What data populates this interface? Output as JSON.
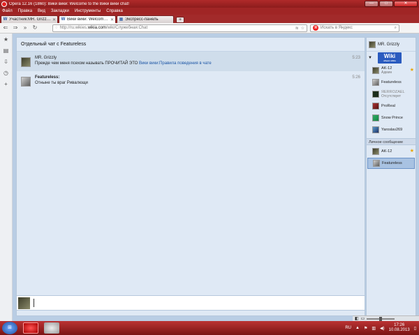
{
  "window": {
    "title": "Opera 12.16 (1860): Вики вики: Welcome to the Вики вики chat!",
    "min": "—",
    "max": "□",
    "close": "✕"
  },
  "menu": [
    "Файл",
    "Правка",
    "Вид",
    "Закладки",
    "Инструменты",
    "Справка"
  ],
  "tabs": [
    {
      "label": "Участник:MR. Grizzly ...",
      "active": false,
      "favicon": "W"
    },
    {
      "label": "Вики вики: Welcome ...",
      "active": true,
      "favicon": "W"
    },
    {
      "label": "Экспресс-панель",
      "active": false,
      "favicon": "▦"
    }
  ],
  "address": {
    "prefix": "http://ru.wikies.",
    "domain": "wikia.com",
    "suffix": "/wiki/Служебная:Chat",
    "search_placeholder": "Искать в Яндекс",
    "search_engine": "Я"
  },
  "chat": {
    "header": "Отдельный чат с Featureless",
    "messages": [
      {
        "user": "MR. Grizzly",
        "text": "Прежде чем меня псехом называть ПРОЧИТАЙ ЭТО ",
        "link": "Вики вики:Правила поведения в чате",
        "time": "5:23"
      },
      {
        "user": "Featureless:",
        "text": "Отныне ты враг Ривалющи",
        "time": "5:26"
      }
    ]
  },
  "userlist": {
    "me": "MR. Grizzly",
    "wiki_logo": "Wiki",
    "wiki_logo_sub": "абыкс wikia",
    "users": [
      {
        "name": "AK-12",
        "sub": "Админ",
        "avatar": "default",
        "star": true
      },
      {
        "name": "Featureless",
        "sub": "",
        "avatar": "bear",
        "star": false
      },
      {
        "name": "ЯERROZAEL",
        "sub": "Отсутствует",
        "avatar": "dark",
        "star": false,
        "away": true
      },
      {
        "name": "ProReal",
        "sub": "",
        "avatar": "red",
        "star": false
      },
      {
        "name": "Snow Prince",
        "sub": "",
        "avatar": "green",
        "star": false
      },
      {
        "name": "Yaroslav269",
        "sub": "",
        "avatar": "blue",
        "star": false
      }
    ],
    "pm_header": "Личное сообщение",
    "pm_users": [
      {
        "name": "AK-12",
        "avatar": "default",
        "star": true,
        "selected": false
      },
      {
        "name": "Featureless",
        "avatar": "bear",
        "star": false,
        "selected": true
      }
    ]
  },
  "taskbar": {
    "lang": "RU",
    "time": "17:26",
    "date": "10.08.2013"
  }
}
